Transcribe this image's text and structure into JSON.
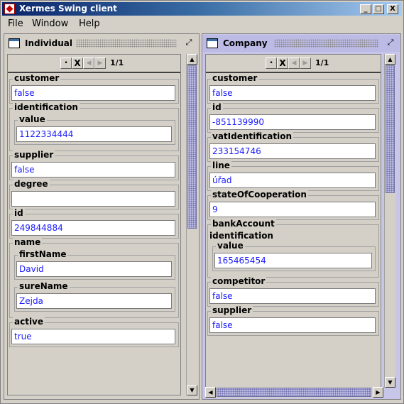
{
  "window": {
    "title": "Xermes Swing client",
    "min_label": "_",
    "max_label": "□",
    "close_label": "X"
  },
  "menubar": [
    "File",
    "Window",
    "Help"
  ],
  "left_frame": {
    "title": "Individual",
    "page_info": "1/1",
    "fields": {
      "customer": {
        "label": "customer",
        "value": "false"
      },
      "identification": {
        "label": "identification",
        "sub_label": "value",
        "sub_value": "1122334444"
      },
      "supplier": {
        "label": "supplier",
        "value": "false"
      },
      "degree": {
        "label": "degree",
        "value": ""
      },
      "id": {
        "label": "id",
        "value": "249844884"
      },
      "name": {
        "label": "name",
        "first_label": "firstName",
        "first_value": "David",
        "sure_label": "sureName",
        "sure_value": "Zejda"
      },
      "active": {
        "label": "active",
        "value": "true"
      }
    }
  },
  "right_frame": {
    "title": "Company",
    "page_info": "1/1",
    "fields": {
      "customer": {
        "label": "customer",
        "value": "false"
      },
      "id": {
        "label": "id",
        "value": "-851139990"
      },
      "vat": {
        "label": "vatIdentification",
        "value": "233154746"
      },
      "line": {
        "label": "line",
        "value": "úřad"
      },
      "state": {
        "label": "stateOfCooperation",
        "value": "9"
      },
      "bank": {
        "label": "bankAccount"
      },
      "identification": {
        "label": "identification",
        "sub_label": "value",
        "sub_value": "165465454"
      },
      "competitor": {
        "label": "competitor",
        "value": "false"
      },
      "supplier": {
        "label": "supplier",
        "value": "false"
      }
    }
  },
  "nav": {
    "x_label": "X"
  }
}
